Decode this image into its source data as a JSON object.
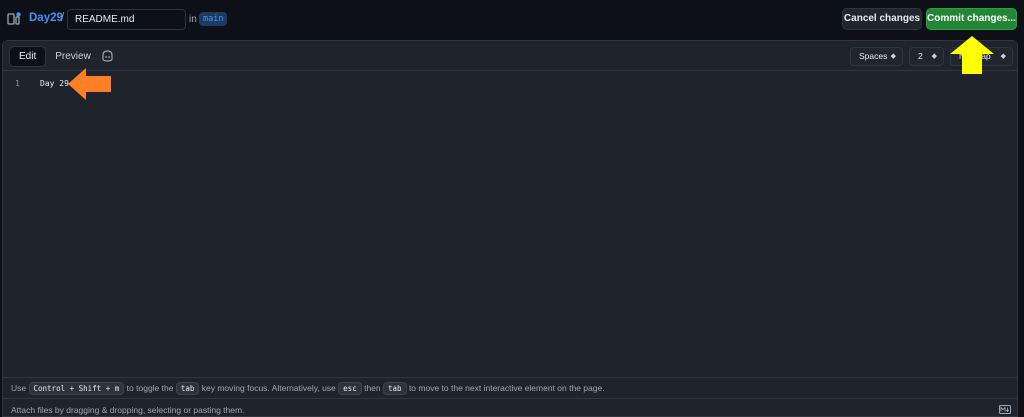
{
  "header": {
    "repo_name": "Day29",
    "separator": "/",
    "filename": "README.md",
    "in_label": "in",
    "branch": "main",
    "cancel_label": "Cancel changes",
    "commit_label": "Commit changes..."
  },
  "editor": {
    "tabs": [
      {
        "label": "Edit",
        "active": true
      },
      {
        "label": "Preview",
        "active": false
      }
    ],
    "indent_mode": "Spaces",
    "indent_size": "2",
    "wrap_mode": "No wrap",
    "lines": [
      {
        "number": "1",
        "text": "Day 29"
      }
    ]
  },
  "footer": {
    "tip_use": "Use",
    "kbd_shortcut": "Control + Shift + m",
    "tip_toggle": "to toggle the",
    "kbd_tab": "tab",
    "tip_alt": "key moving focus. Alternatively, use",
    "kbd_esc": "esc",
    "tip_then": "then",
    "kbd_tab2": "tab",
    "tip_end": "to move to the next interactive element on the page.",
    "attach_text": "Attach files by dragging & dropping, selecting or pasting them."
  },
  "colors": {
    "background": "#0d1117",
    "panel": "#1f242c",
    "accent_link": "#4493f8",
    "commit_green": "#238636",
    "annotation_orange": "#ff7f27",
    "annotation_yellow": "#ffff00"
  },
  "icons": [
    "file-tree-icon",
    "copilot-icon",
    "markdown-icon",
    "chevron-updown-icon"
  ]
}
